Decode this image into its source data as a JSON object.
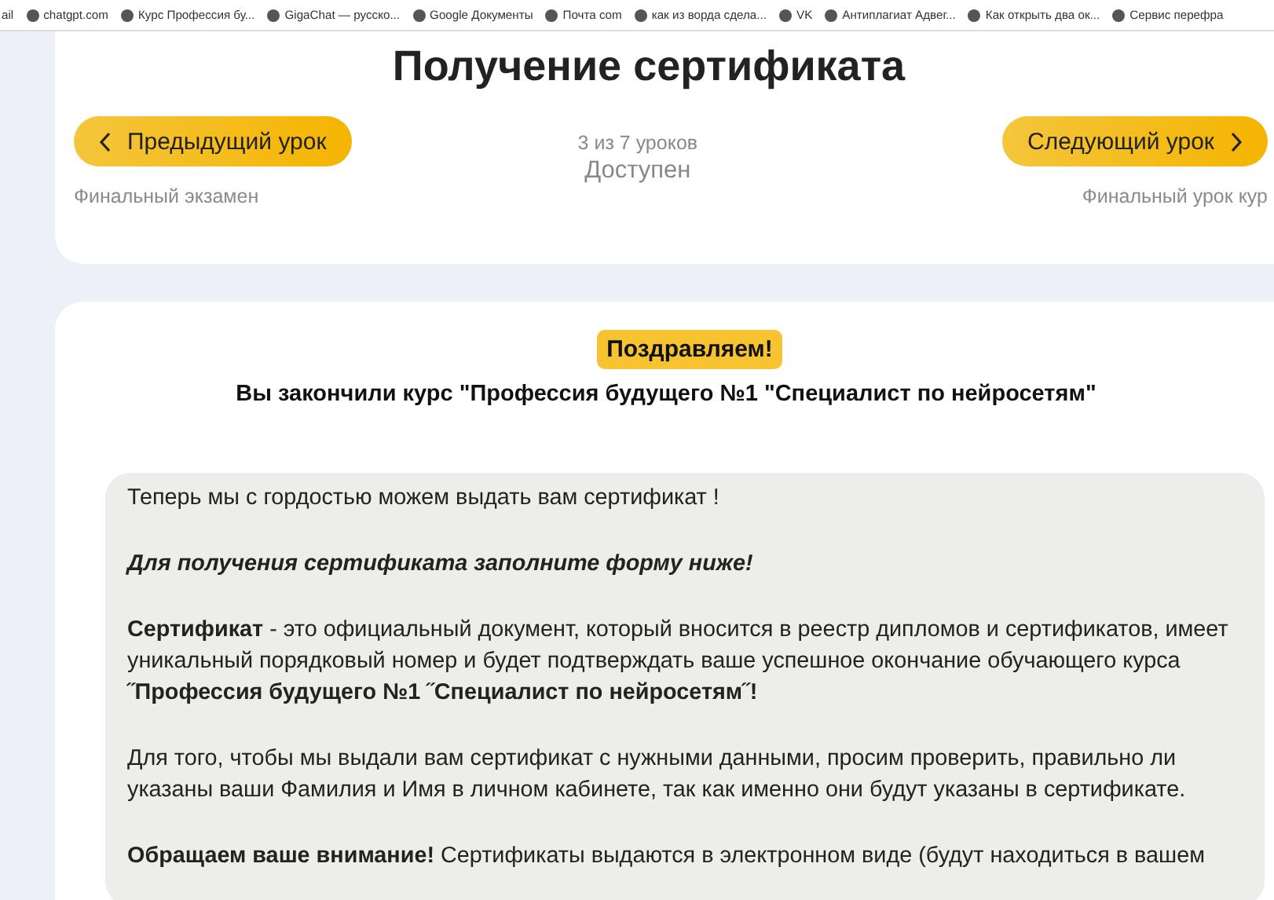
{
  "bookmarks": [
    {
      "label": "ail"
    },
    {
      "label": "chatgpt.com"
    },
    {
      "label": "Курс Профессия бу..."
    },
    {
      "label": "GigaChat — русско..."
    },
    {
      "label": "Google Документы"
    },
    {
      "label": "Почта com"
    },
    {
      "label": "как из ворда сдела..."
    },
    {
      "label": "VK"
    },
    {
      "label": "Антиплагиат Адвег..."
    },
    {
      "label": "Как открыть два ок..."
    },
    {
      "label": "Сервис перефра"
    }
  ],
  "lesson": {
    "title": "Получение сертификата",
    "prev_button": "Предыдущий урок",
    "prev_caption": "Финальный экзамен",
    "progress": "3 из 7 уроков",
    "status": "Доступен",
    "next_button": "Следующий урок",
    "next_caption": "Финальный урок кур"
  },
  "result": {
    "badge": "Поздравляем!",
    "heading": "Вы закончили курс \"Профессия будущего №1 \"Специалист по нейросетям\"",
    "paragraphs": [
      "Теперь мы с гордостью можем выдать вам сертификат !",
      "**Для получения сертификата заполните форму ниже!**",
      "**Сертификат**  - это официальный документ, который вносится в реестр дипломов и сертификатов, имеет уникальный порядковый номер и будет подтверждать ваше успешное окончание обучающего курса  **˝Профессия будущего №1  ˝Специалист по нейросетям˝!**",
      "Для того, чтобы мы выдали вам сертификат с нужными данными, просим проверить, правильно ли указаны ваши Фамилия и Имя в личном кабинете, так как именно они будут указаны в сертификате.",
      "**Обращаем ваше внимание!** Сертификаты выдаются в электронном виде (будут находиться в вашем"
    ]
  }
}
